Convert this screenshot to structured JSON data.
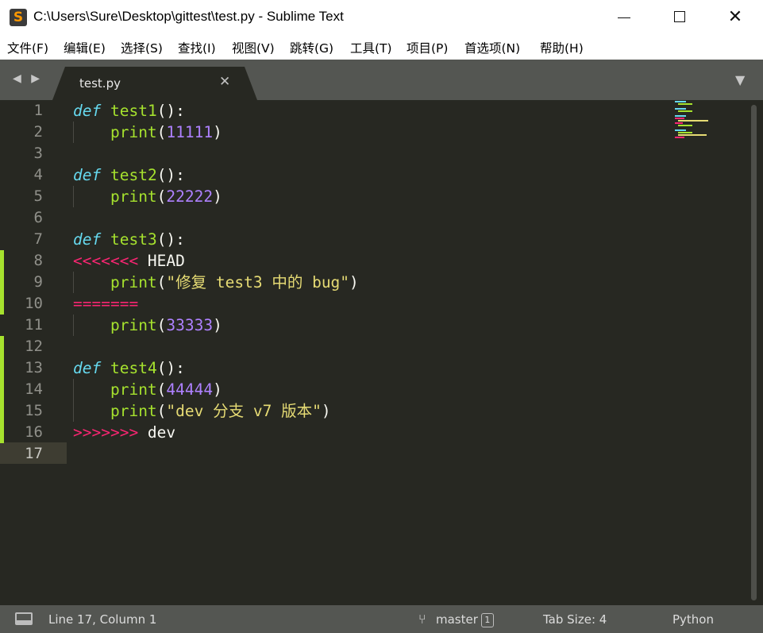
{
  "window": {
    "title": "C:\\Users\\Sure\\Desktop\\gittest\\test.py - Sublime Text",
    "app_icon_glyph": "S",
    "minimize_label": "",
    "maximize_label": "",
    "close_label": "✕"
  },
  "menu": {
    "items": [
      "文件(F)",
      "编辑(E)",
      "选择(S)",
      "查找(I)",
      "视图(V)",
      "跳转(G)",
      "工具(T)",
      "项目(P)",
      "首选项(N)",
      "帮助(H)"
    ]
  },
  "tabs": {
    "nav": "◀ ▶",
    "active": {
      "label": "test.py",
      "close": "✕"
    },
    "dropdown": "▼"
  },
  "editor": {
    "current_line": 17,
    "line_numbers": [
      "1",
      "2",
      "3",
      "4",
      "5",
      "6",
      "7",
      "8",
      "9",
      "10",
      "11",
      "12",
      "13",
      "14",
      "15",
      "16",
      "17"
    ],
    "lines": [
      [
        {
          "t": "def",
          "c": "kw"
        },
        {
          "t": " "
        },
        {
          "t": "test1",
          "c": "fn"
        },
        {
          "t": "():"
        }
      ],
      [
        {
          "t": "    "
        },
        {
          "t": "print",
          "c": "fn"
        },
        {
          "t": "("
        },
        {
          "t": "11111",
          "c": "num"
        },
        {
          "t": ")"
        }
      ],
      [],
      [
        {
          "t": "def",
          "c": "kw"
        },
        {
          "t": " "
        },
        {
          "t": "test2",
          "c": "fn"
        },
        {
          "t": "():"
        }
      ],
      [
        {
          "t": "    "
        },
        {
          "t": "print",
          "c": "fn"
        },
        {
          "t": "("
        },
        {
          "t": "22222",
          "c": "num"
        },
        {
          "t": ")"
        }
      ],
      [],
      [
        {
          "t": "def",
          "c": "kw"
        },
        {
          "t": " "
        },
        {
          "t": "test3",
          "c": "fn"
        },
        {
          "t": "():"
        }
      ],
      [
        {
          "t": "<<<<<<<",
          "c": "conflict"
        },
        {
          "t": " HEAD"
        }
      ],
      [
        {
          "t": "    "
        },
        {
          "t": "print",
          "c": "fn"
        },
        {
          "t": "("
        },
        {
          "t": "\"修复 test3 中的 bug\"",
          "c": "str"
        },
        {
          "t": ")"
        }
      ],
      [
        {
          "t": "=======",
          "c": "conflict"
        }
      ],
      [
        {
          "t": "    "
        },
        {
          "t": "print",
          "c": "fn"
        },
        {
          "t": "("
        },
        {
          "t": "33333",
          "c": "num"
        },
        {
          "t": ")"
        }
      ],
      [],
      [
        {
          "t": "def",
          "c": "kw"
        },
        {
          "t": " "
        },
        {
          "t": "test4",
          "c": "fn"
        },
        {
          "t": "():"
        }
      ],
      [
        {
          "t": "    "
        },
        {
          "t": "print",
          "c": "fn"
        },
        {
          "t": "("
        },
        {
          "t": "44444",
          "c": "num"
        },
        {
          "t": ")"
        }
      ],
      [
        {
          "t": "    "
        },
        {
          "t": "print",
          "c": "fn"
        },
        {
          "t": "("
        },
        {
          "t": "\"dev 分支 v7 版本\"",
          "c": "str"
        },
        {
          "t": ")"
        }
      ],
      [
        {
          "t": ">>>>>>>",
          "c": "conflict"
        },
        {
          "t": " dev"
        }
      ],
      []
    ],
    "git_modified_lines": [
      8,
      9,
      10,
      12,
      13,
      14,
      15,
      16
    ]
  },
  "status": {
    "position": "Line 17, Column 1",
    "branch": "master",
    "branch_badge": "1",
    "tab_size": "Tab Size: 4",
    "syntax": "Python"
  },
  "colors": {
    "editor_bg": "#272822",
    "keyword": "#66d9ef",
    "function": "#a6e22e",
    "number": "#ae81ff",
    "string": "#e6db74",
    "conflict": "#f92672",
    "git_modified": "#a6e22e"
  }
}
